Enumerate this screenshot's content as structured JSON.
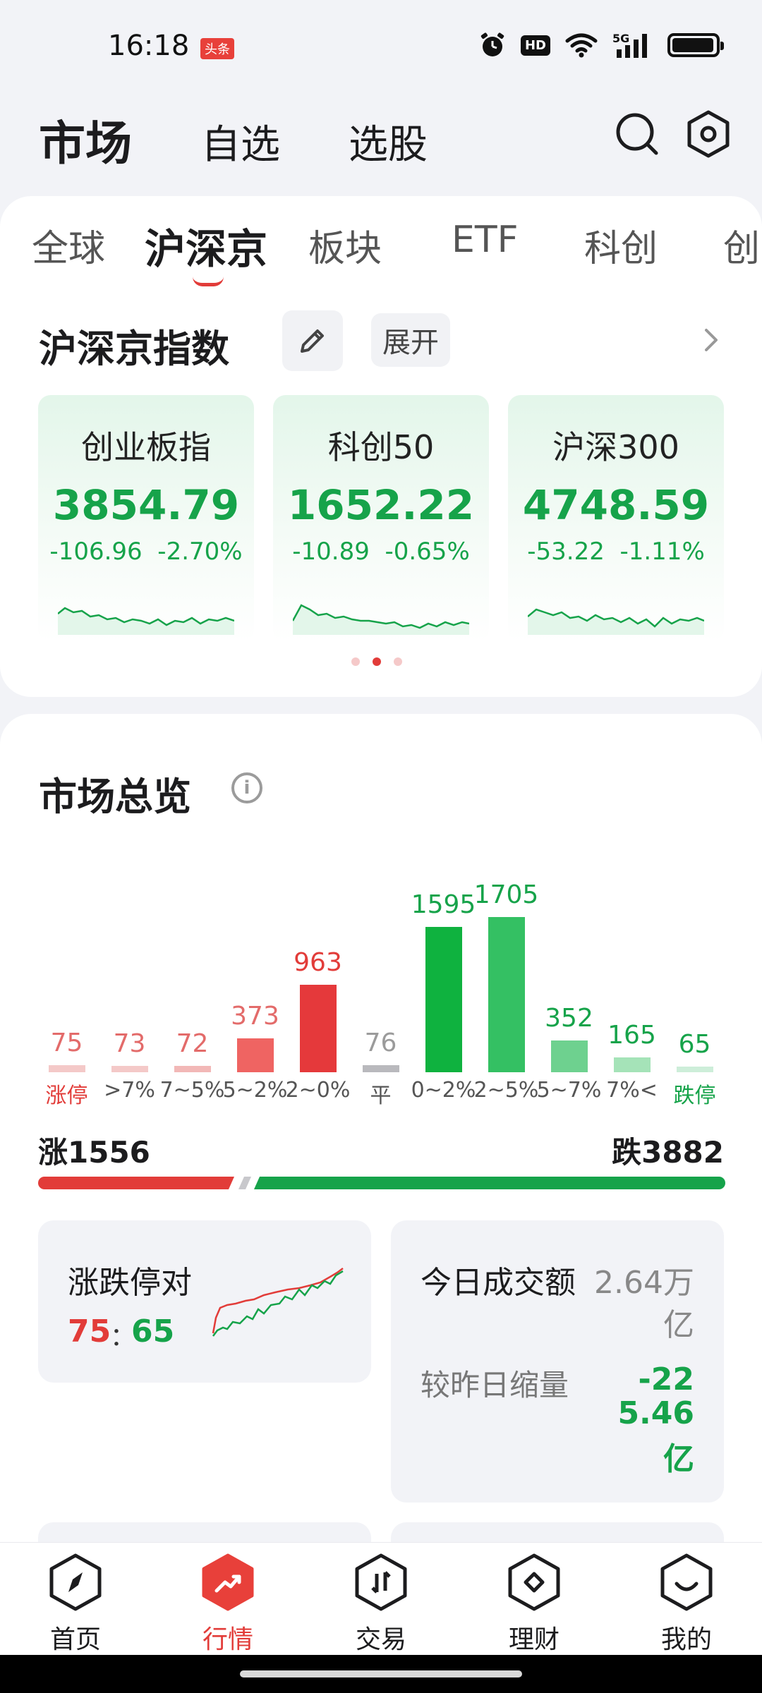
{
  "status_bar": {
    "time": "16:18",
    "badge": "头条",
    "hd": "HD",
    "signal": "5G"
  },
  "header": {
    "title": "市场",
    "tabs": [
      "自选",
      "选股"
    ]
  },
  "category_tabs": [
    {
      "label": "全球",
      "active": false
    },
    {
      "label": "沪深京",
      "active": true
    },
    {
      "label": "板块",
      "active": false
    },
    {
      "label": "ETF",
      "active": false
    },
    {
      "label": "科创",
      "active": false
    },
    {
      "label": "创",
      "active": false
    }
  ],
  "index_section": {
    "title": "沪深京指数",
    "expand_label": "展开",
    "cards": [
      {
        "name": "创业板指",
        "value": "3854.79",
        "change": "-106.96",
        "pct": "-2.70%"
      },
      {
        "name": "科创50",
        "value": "1652.22",
        "change": "-10.89",
        "pct": "-0.65%"
      },
      {
        "name": "沪深300",
        "value": "4748.59",
        "change": "-53.22",
        "pct": "-1.11%"
      }
    ]
  },
  "overview": {
    "title": "市场总览",
    "rise_label": "涨1556",
    "fall_label": "跌3882",
    "colors": {
      "up": "#e23c39",
      "down": "#16a34a",
      "flat": "#9b9b9b"
    }
  },
  "chart_data": {
    "type": "bar",
    "categories": [
      "涨停",
      ">7%",
      "7~5%",
      "5~2%",
      "2~0%",
      "平",
      "0~2%",
      "2~5%",
      "5~7%",
      "7%<",
      "跌停"
    ],
    "values": [
      75,
      73,
      72,
      373,
      963,
      76,
      1595,
      1705,
      352,
      165,
      65
    ],
    "ylim": [
      0,
      1705
    ]
  },
  "limit_panel": {
    "title": "涨跌停对",
    "up": "75",
    "sep": "：",
    "down": "65"
  },
  "volume_panel": {
    "title": "今日成交额",
    "value_line1": "2.64万",
    "value_line2": "亿",
    "sub_label": "较昨日缩量",
    "delta_line1": "-22",
    "delta_line2": "5.46",
    "delta_line3": "亿"
  },
  "bottom_nav": [
    {
      "label": "首页",
      "active": false
    },
    {
      "label": "行情",
      "active": true
    },
    {
      "label": "交易",
      "active": false
    },
    {
      "label": "理财",
      "active": false
    },
    {
      "label": "我的",
      "active": false
    }
  ]
}
